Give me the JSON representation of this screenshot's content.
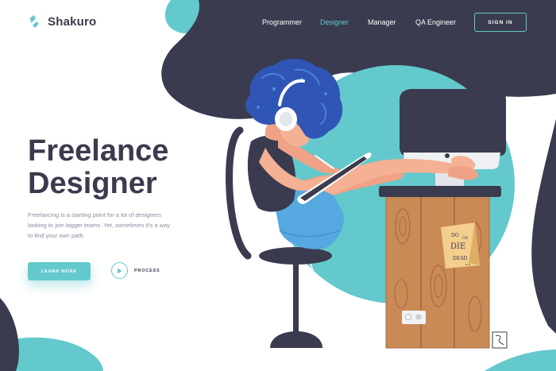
{
  "brand": {
    "name": "Shakuro",
    "logo_icon": "shakuro-logo-icon"
  },
  "nav": {
    "items": [
      {
        "label": "Programmer",
        "active": false
      },
      {
        "label": "Designer",
        "active": true
      },
      {
        "label": "Manager",
        "active": false
      },
      {
        "label": "QA Engineer",
        "active": false
      }
    ],
    "signin_label": "SIGN IN"
  },
  "hero": {
    "title_line1": "Freelance",
    "title_line2": "Designer",
    "description": "Freelancing is a starting point for a lot of designers looking to join bigger teams. Yet, sometimes it's a way to find your own path.",
    "learn_more_label": "LEARN MORE",
    "process_label": "PROCESS",
    "play_icon": "play-icon"
  },
  "illustration": {
    "note_lines": [
      "DO",
      "OR",
      "DIE",
      "DEAD",
      "x x"
    ]
  },
  "colors": {
    "accent": "#63c9cc",
    "dark": "#3d3a4f",
    "text_muted": "#8d8aa0",
    "background": "#ffffff",
    "wood": "#c98a56",
    "hair": "#2f56b5"
  }
}
